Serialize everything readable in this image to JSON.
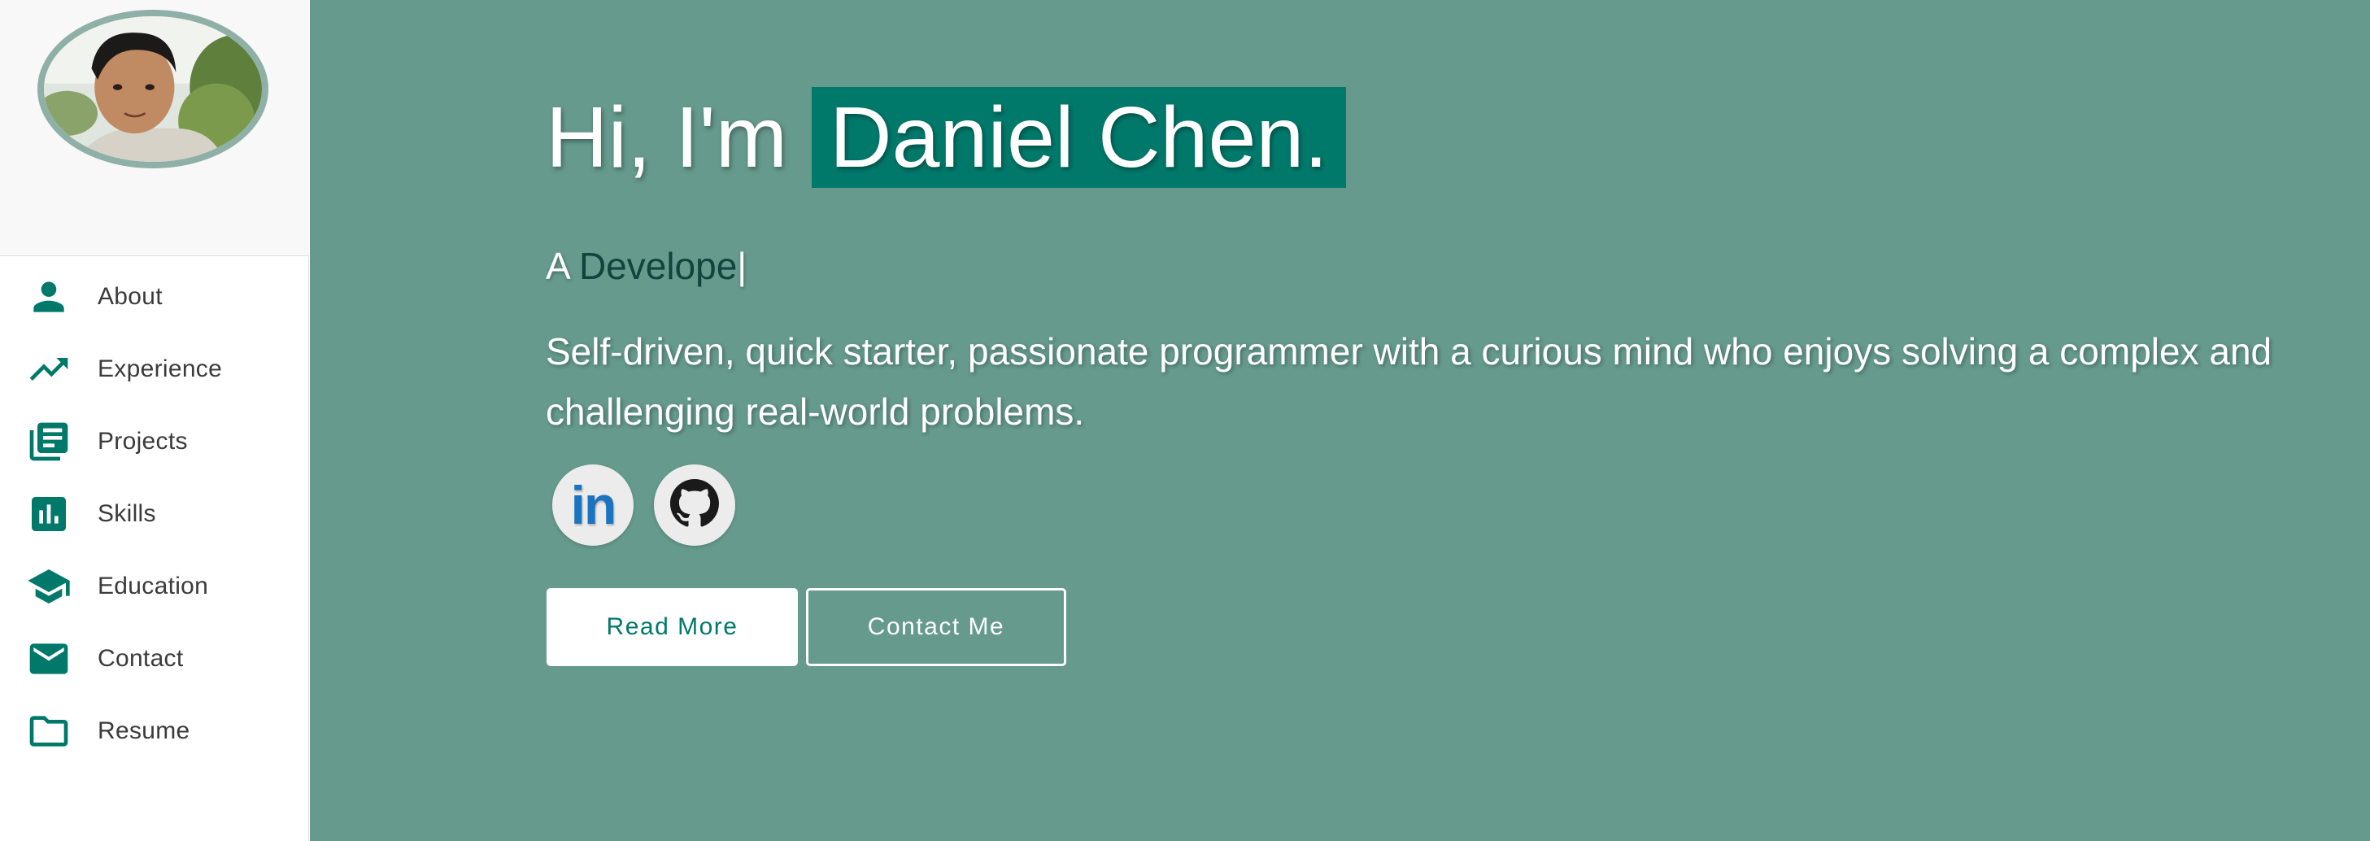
{
  "sidebar": {
    "items": [
      {
        "label": "About",
        "icon": "person-icon"
      },
      {
        "label": "Experience",
        "icon": "trending-up-icon"
      },
      {
        "label": "Projects",
        "icon": "library-books-icon"
      },
      {
        "label": "Skills",
        "icon": "bar-chart-icon"
      },
      {
        "label": "Education",
        "icon": "graduation-cap-icon"
      },
      {
        "label": "Contact",
        "icon": "mail-icon"
      },
      {
        "label": "Resume",
        "icon": "folder-icon"
      }
    ]
  },
  "hero": {
    "greeting": "Hi, I'm",
    "name": "Daniel Chen.",
    "subtitle_prefix": "A",
    "subtitle_typed": "Develope",
    "caret": "|",
    "description": "Self-driven, quick starter, passionate programmer with a curious mind who enjoys solving a complex and challenging real-world problems.",
    "linkedin_text": "in",
    "read_more": "Read More",
    "contact_me": "Contact Me"
  },
  "colors": {
    "accent": "#00796b",
    "background": "#659a8c",
    "avatar_border": "#8fb0a6"
  }
}
